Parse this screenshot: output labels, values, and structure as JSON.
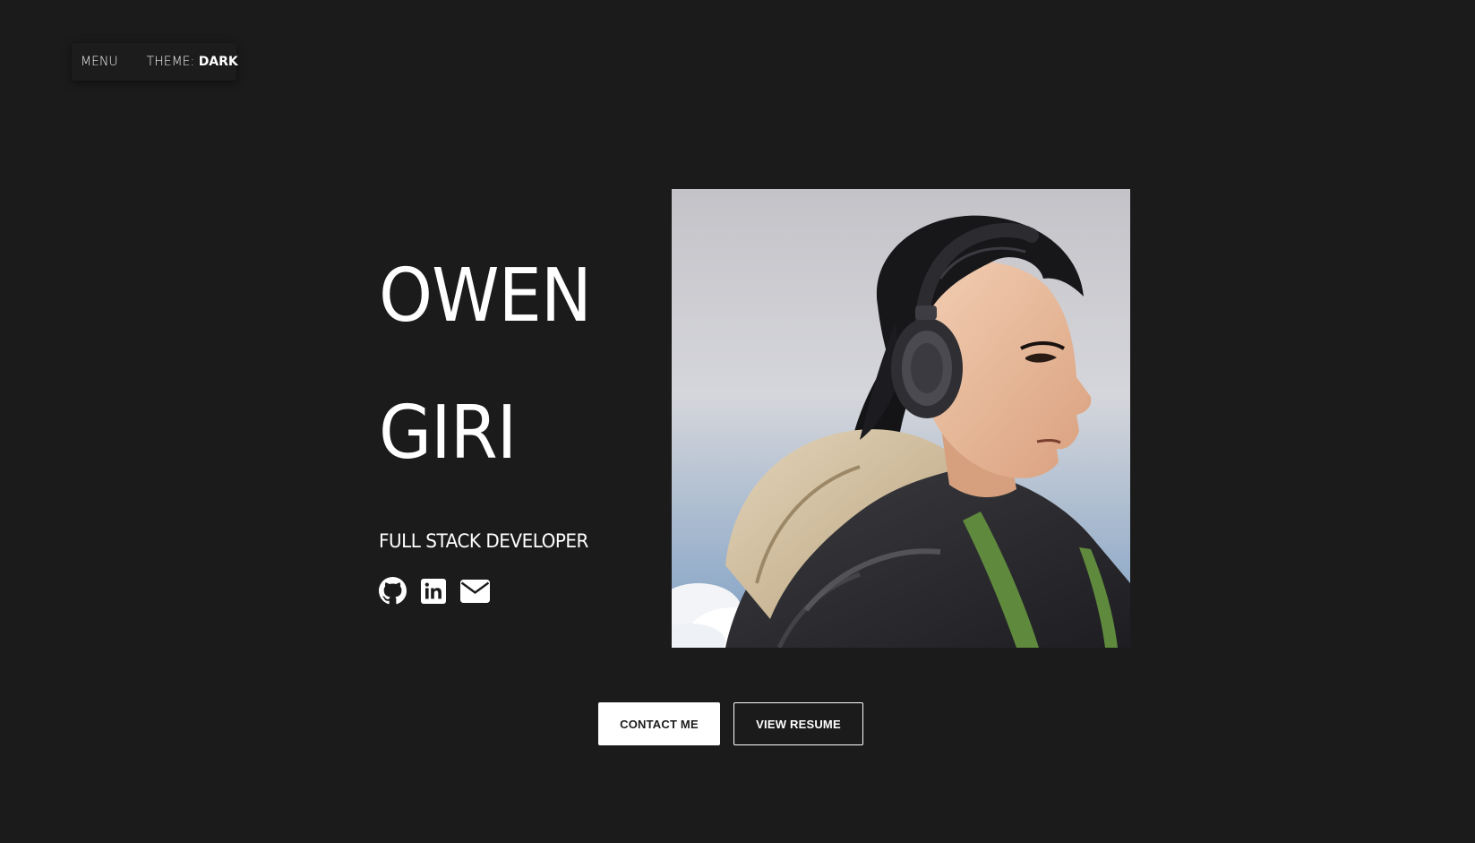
{
  "nav": {
    "menu_label": "MENU",
    "theme_label": "THEME: ",
    "theme_value": "DARK"
  },
  "hero": {
    "first_name": "OWEN",
    "last_name": "GIRI",
    "title": "FULL STACK DEVELOPER",
    "socials": [
      {
        "icon": "github-icon"
      },
      {
        "icon": "linkedin-icon"
      },
      {
        "icon": "envelope-icon"
      }
    ],
    "portrait_icon": "avatar-illustration"
  },
  "actions": {
    "contact_label": "CONTACT ME",
    "resume_label": "VIEW RESUME"
  },
  "colors": {
    "background": "#1b1b1b",
    "text": "#ffffff",
    "button_primary_bg": "#ffffff",
    "button_primary_text": "#1b1b1b"
  }
}
